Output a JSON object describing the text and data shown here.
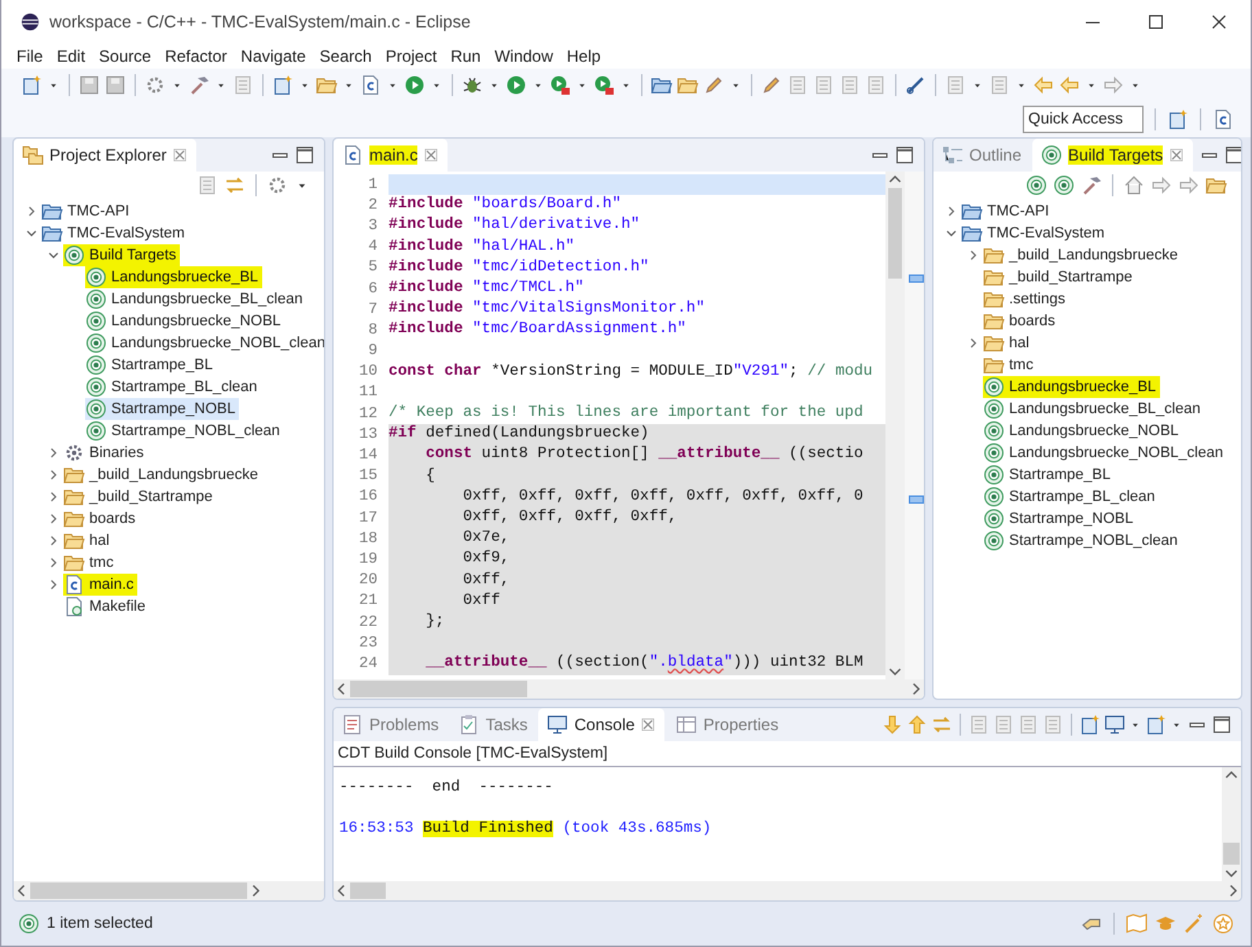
{
  "window": {
    "title": "workspace - C/C++ - TMC-EvalSystem/main.c - Eclipse"
  },
  "menu": [
    "File",
    "Edit",
    "Source",
    "Refactor",
    "Navigate",
    "Search",
    "Project",
    "Run",
    "Window",
    "Help"
  ],
  "quick_access": {
    "placeholder": "Quick Access"
  },
  "explorer": {
    "tabs": [
      {
        "label": "Project Explorer",
        "kind": "explorer",
        "selected": true,
        "highlighted": false
      }
    ],
    "items": [
      {
        "label": "TMC-API",
        "kind": "project",
        "expanded": false,
        "selected": false,
        "highlighted": false
      },
      {
        "label": "TMC-EvalSystem",
        "kind": "project",
        "expanded": true,
        "selected": false,
        "highlighted": false,
        "children": [
          {
            "label": "Build Targets",
            "kind": "target",
            "expanded": true,
            "selected": false,
            "highlighted": true,
            "children": [
              {
                "label": "Landungsbruecke_BL",
                "kind": "target",
                "selected": false,
                "highlighted": true
              },
              {
                "label": "Landungsbruecke_BL_clean",
                "kind": "target",
                "selected": false,
                "highlighted": false
              },
              {
                "label": "Landungsbruecke_NOBL",
                "kind": "target",
                "selected": false,
                "highlighted": false
              },
              {
                "label": "Landungsbruecke_NOBL_clean",
                "kind": "target",
                "selected": false,
                "highlighted": false
              },
              {
                "label": "Startrampe_BL",
                "kind": "target",
                "selected": false,
                "highlighted": false
              },
              {
                "label": "Startrampe_BL_clean",
                "kind": "target",
                "selected": false,
                "highlighted": false
              },
              {
                "label": "Startrampe_NOBL",
                "kind": "target",
                "selected": true,
                "highlighted": false
              },
              {
                "label": "Startrampe_NOBL_clean",
                "kind": "target",
                "selected": false,
                "highlighted": false
              }
            ]
          },
          {
            "label": "Binaries",
            "kind": "binaries",
            "expanded": false,
            "selected": false,
            "highlighted": false
          },
          {
            "label": "_build_Landungsbruecke",
            "kind": "folder",
            "expanded": false,
            "selected": false,
            "highlighted": false
          },
          {
            "label": "_build_Startrampe",
            "kind": "folder",
            "expanded": false,
            "selected": false,
            "highlighted": false
          },
          {
            "label": "boards",
            "kind": "folder",
            "expanded": false,
            "selected": false,
            "highlighted": false
          },
          {
            "label": "hal",
            "kind": "folder",
            "expanded": false,
            "selected": false,
            "highlighted": false
          },
          {
            "label": "tmc",
            "kind": "folder",
            "expanded": false,
            "selected": false,
            "highlighted": false
          },
          {
            "label": "main.c",
            "kind": "c-file",
            "expanded": false,
            "selected": false,
            "highlighted": true
          },
          {
            "label": "Makefile",
            "kind": "makefile",
            "selected": false,
            "highlighted": false
          }
        ]
      }
    ]
  },
  "editor": {
    "tabs": [
      {
        "label": "main.c",
        "kind": "c-file",
        "selected": true,
        "highlighted": true
      }
    ],
    "lines": [
      {
        "number": "1",
        "current": true,
        "inactive": false
      },
      {
        "number": "2",
        "current": false,
        "inactive": false,
        "segments": [
          {
            "kind": "keyword",
            "text": "#include"
          },
          {
            "kind": "string",
            "text": " \"boards/Board.h\""
          }
        ]
      },
      {
        "number": "3",
        "current": false,
        "inactive": false,
        "segments": [
          {
            "kind": "keyword",
            "text": "#include"
          },
          {
            "kind": "string",
            "text": " \"hal/derivative.h\""
          }
        ]
      },
      {
        "number": "4",
        "current": false,
        "inactive": false,
        "segments": [
          {
            "kind": "keyword",
            "text": "#include"
          },
          {
            "kind": "string",
            "text": " \"hal/HAL.h\""
          }
        ]
      },
      {
        "number": "5",
        "current": false,
        "inactive": false,
        "segments": [
          {
            "kind": "keyword",
            "text": "#include"
          },
          {
            "kind": "string",
            "text": " \"tmc/idDetection.h\""
          }
        ]
      },
      {
        "number": "6",
        "current": false,
        "inactive": false,
        "segments": [
          {
            "kind": "keyword",
            "text": "#include"
          },
          {
            "kind": "string",
            "text": " \"tmc/TMCL.h\""
          }
        ]
      },
      {
        "number": "7",
        "current": false,
        "inactive": false,
        "segments": [
          {
            "kind": "keyword",
            "text": "#include"
          },
          {
            "kind": "string",
            "text": " \"tmc/VitalSignsMonitor.h\""
          }
        ]
      },
      {
        "number": "8",
        "current": false,
        "inactive": false,
        "segments": [
          {
            "kind": "keyword",
            "text": "#include"
          },
          {
            "kind": "string",
            "text": " \"tmc/BoardAssignment.h\""
          }
        ]
      },
      {
        "number": "9",
        "current": false,
        "inactive": false
      },
      {
        "number": "10",
        "current": false,
        "inactive": false,
        "segments": [
          {
            "kind": "keyword",
            "text": "const"
          },
          {
            "kind": "keyword",
            "text": " char"
          },
          {
            "kind": "plain",
            "text": " *VersionString = MODULE_ID"
          },
          {
            "kind": "string",
            "text": "\"V291\""
          },
          {
            "kind": "plain",
            "text": "; "
          },
          {
            "kind": "comment",
            "text": "// modu"
          }
        ]
      },
      {
        "number": "11",
        "current": false,
        "inactive": false
      },
      {
        "number": "12",
        "current": false,
        "inactive": false,
        "segments": [
          {
            "kind": "comment",
            "text": "/* Keep as is! This lines are important for the upd"
          }
        ]
      },
      {
        "number": "13",
        "current": false,
        "inactive": true,
        "segments": [
          {
            "kind": "keyword",
            "text": "#if"
          },
          {
            "kind": "plain",
            "text": " defined(Landungsbruecke)"
          }
        ]
      },
      {
        "number": "14",
        "current": false,
        "inactive": true,
        "segments": [
          {
            "kind": "keyword",
            "text": "    const"
          },
          {
            "kind": "plain",
            "text": " uint8 Protection[] "
          },
          {
            "kind": "keyword",
            "text": "__attribute__"
          },
          {
            "kind": "plain",
            "text": " ((sectio"
          }
        ]
      },
      {
        "number": "15",
        "current": false,
        "inactive": true,
        "segments": [
          {
            "kind": "plain",
            "text": "    {"
          }
        ]
      },
      {
        "number": "16",
        "current": false,
        "inactive": true,
        "segments": [
          {
            "kind": "plain",
            "text": "        0xff, 0xff, 0xff, 0xff, 0xff, 0xff, 0xff, 0"
          }
        ]
      },
      {
        "number": "17",
        "current": false,
        "inactive": true,
        "segments": [
          {
            "kind": "plain",
            "text": "        0xff, 0xff, 0xff, 0xff,"
          }
        ]
      },
      {
        "number": "18",
        "current": false,
        "inactive": true,
        "segments": [
          {
            "kind": "plain",
            "text": "        0x7e,"
          }
        ]
      },
      {
        "number": "19",
        "current": false,
        "inactive": true,
        "segments": [
          {
            "kind": "plain",
            "text": "        0xf9,"
          }
        ]
      },
      {
        "number": "20",
        "current": false,
        "inactive": true,
        "segments": [
          {
            "kind": "plain",
            "text": "        0xff,"
          }
        ]
      },
      {
        "number": "21",
        "current": false,
        "inactive": true,
        "segments": [
          {
            "kind": "plain",
            "text": "        0xff"
          }
        ]
      },
      {
        "number": "22",
        "current": false,
        "inactive": true,
        "segments": [
          {
            "kind": "plain",
            "text": "    };"
          }
        ]
      },
      {
        "number": "23",
        "current": false,
        "inactive": true
      },
      {
        "number": "24",
        "current": false,
        "inactive": true,
        "segments": [
          {
            "kind": "keyword",
            "text": "    __attribute__"
          },
          {
            "kind": "plain",
            "text": " ((section("
          },
          {
            "kind": "string",
            "text": "\"."
          },
          {
            "kind": "misspelled",
            "text": "bldata"
          },
          {
            "kind": "string",
            "text": "\""
          },
          {
            "kind": "plain",
            "text": "))) uint32 BLM"
          }
        ]
      }
    ]
  },
  "targets_view": {
    "tabs": [
      {
        "label": "Outline",
        "kind": "outline",
        "selected": false,
        "highlighted": false
      },
      {
        "label": "Build Targets",
        "kind": "target",
        "selected": true,
        "highlighted": true
      }
    ],
    "items": [
      {
        "label": "TMC-API",
        "kind": "project",
        "expanded": false,
        "selected": false,
        "highlighted": false
      },
      {
        "label": "TMC-EvalSystem",
        "kind": "project",
        "expanded": true,
        "selected": false,
        "highlighted": false,
        "children": [
          {
            "label": "_build_Landungsbruecke",
            "kind": "folder",
            "expanded": false,
            "selected": false,
            "highlighted": false
          },
          {
            "label": "_build_Startrampe",
            "kind": "folder",
            "selected": false,
            "highlighted": false
          },
          {
            "label": ".settings",
            "kind": "folder",
            "selected": false,
            "highlighted": false
          },
          {
            "label": "boards",
            "kind": "folder",
            "selected": false,
            "highlighted": false
          },
          {
            "label": "hal",
            "kind": "folder",
            "expanded": false,
            "selected": false,
            "highlighted": false
          },
          {
            "label": "tmc",
            "kind": "folder",
            "selected": false,
            "highlighted": false
          },
          {
            "label": "Landungsbruecke_BL",
            "kind": "target",
            "selected": false,
            "highlighted": true
          },
          {
            "label": "Landungsbruecke_BL_clean",
            "kind": "target",
            "selected": false,
            "highlighted": false
          },
          {
            "label": "Landungsbruecke_NOBL",
            "kind": "target",
            "selected": false,
            "highlighted": false
          },
          {
            "label": "Landungsbruecke_NOBL_clean",
            "kind": "target",
            "selected": false,
            "highlighted": false
          },
          {
            "label": "Startrampe_BL",
            "kind": "target",
            "selected": false,
            "highlighted": false
          },
          {
            "label": "Startrampe_BL_clean",
            "kind": "target",
            "selected": false,
            "highlighted": false
          },
          {
            "label": "Startrampe_NOBL",
            "kind": "target",
            "selected": false,
            "highlighted": false
          },
          {
            "label": "Startrampe_NOBL_clean",
            "kind": "target",
            "selected": false,
            "highlighted": false
          }
        ]
      }
    ]
  },
  "console": {
    "tabs": [
      {
        "label": "Problems",
        "kind": "problems",
        "selected": false
      },
      {
        "label": "Tasks",
        "kind": "tasks",
        "selected": false
      },
      {
        "label": "Console",
        "kind": "console",
        "selected": true
      },
      {
        "label": "Properties",
        "kind": "properties",
        "selected": false
      }
    ],
    "title": "CDT Build Console [TMC-EvalSystem]",
    "lines": [
      [
        {
          "kind": "plain",
          "text": "--------  end  --------"
        }
      ],
      [
        {
          "kind": "info",
          "text": "16:53:53 "
        },
        {
          "kind": "highlight",
          "text": "Build Finished"
        },
        {
          "kind": "info",
          "text": " (took 43s.685ms)"
        }
      ]
    ]
  },
  "status_bar": {
    "text": "1 item selected"
  }
}
